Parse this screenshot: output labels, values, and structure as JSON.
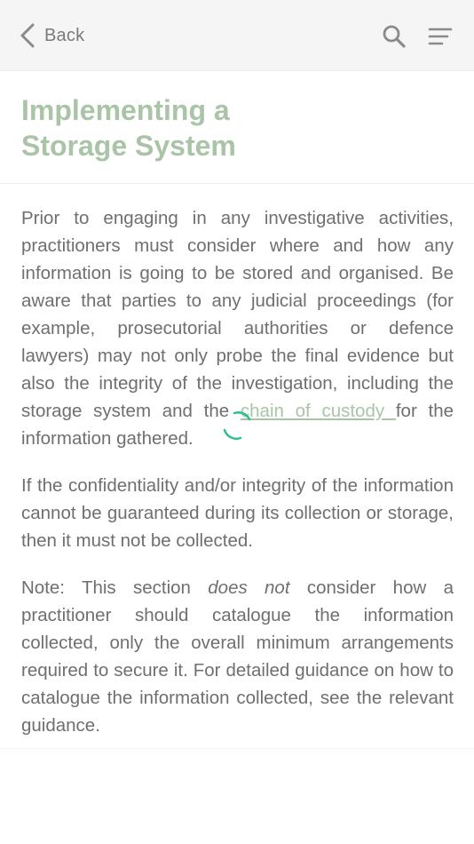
{
  "header": {
    "back_label": "Back",
    "back_icon": "chevron-left-icon",
    "search_icon": "search-icon",
    "menu_icon": "menu-icon"
  },
  "page": {
    "title": "Implementing a Storage System"
  },
  "body": {
    "p1_before": "Prior to engaging in any investigative activities, practitioners must consider where and how any information is going to be stored and organised. Be aware that parties to any judicial proceedings (for example, prosecutorial authorities or defence lawyers) may not only probe the final evidence but also the integrity of the investigation, including the storage system and the ",
    "p1_link": "chain of custody ",
    "p1_after": " for the information gathered.",
    "p2": "If the confidentiality and/or integrity of the information cannot be guaranteed during its collection or storage, then it must not be collected.",
    "p3_before": "Note: This section ",
    "p3_emphasis": "does not",
    "p3_after": " consider how a practitioner should catalogue the information collected, only the overall minimum arrangements required to secure it. For detailed guidance on how to catalogue the information collected, see the relevant guidance."
  },
  "colors": {
    "accent": "#a9c4a6",
    "spinner": "#2bbf8f",
    "text": "#6f6f6f",
    "header_bg": "#f5f5f5"
  }
}
